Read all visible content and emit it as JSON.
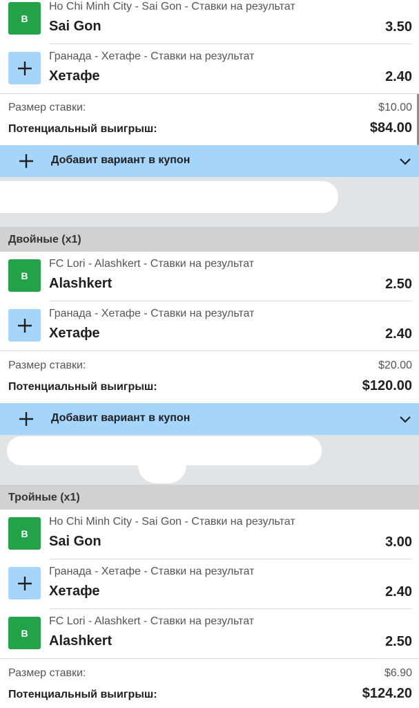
{
  "block1": {
    "bets": [
      {
        "badge": "B",
        "event": "Ho Chi Minh City - Sai Gon - Ставки на результат",
        "team": "Sai Gon",
        "odds": "3.50"
      },
      {
        "badge": "+",
        "event": "Гранада - Хетафе - Ставки на результат",
        "team": "Хетафе",
        "odds": "2.40"
      }
    ],
    "stake_label": "Размер ставки:",
    "stake_value": "$10.00",
    "win_label": "Потенциальный выигрыш:",
    "win_value": "$84.00",
    "coupon_label": "Добавит вариант в купон"
  },
  "block2": {
    "title": "Двойные (x1)",
    "bets": [
      {
        "badge": "B",
        "event": "FC Lori - Alashkert - Ставки на результат",
        "team": "Alashkert",
        "odds": "2.50"
      },
      {
        "badge": "+",
        "event": "Гранада - Хетафе - Ставки на результат",
        "team": "Хетафе",
        "odds": "2.40"
      }
    ],
    "stake_label": "Размер ставки:",
    "stake_value": "$20.00",
    "win_label": "Потенциальный выигрыш:",
    "win_value": "$120.00",
    "coupon_label": "Добавит вариант в купон"
  },
  "block3": {
    "title": "Тройные (x1)",
    "bets": [
      {
        "badge": "B",
        "event": "Ho Chi Minh City - Sai Gon - Ставки на результат",
        "team": "Sai Gon",
        "odds": "3.00"
      },
      {
        "badge": "+",
        "event": "Гранада - Хетафе - Ставки на результат",
        "team": "Хетафе",
        "odds": "2.40"
      },
      {
        "badge": "B",
        "event": "FC Lori - Alashkert - Ставки на результат",
        "team": "Alashkert",
        "odds": "2.50"
      }
    ],
    "stake_label": "Размер ставки:",
    "stake_value": "$6.90",
    "win_label": "Потенциальный выигрыш:",
    "win_value": "$124.20"
  },
  "icons": {
    "add": "plus-icon",
    "expand": "chevron-down-icon"
  },
  "colors": {
    "selected_badge": "#23a249",
    "add_badge": "#a6d5fb",
    "coupon_bar": "#a6d5fb",
    "section_header": "#cfd1d3",
    "redacted_area": "#e1e4e6"
  }
}
